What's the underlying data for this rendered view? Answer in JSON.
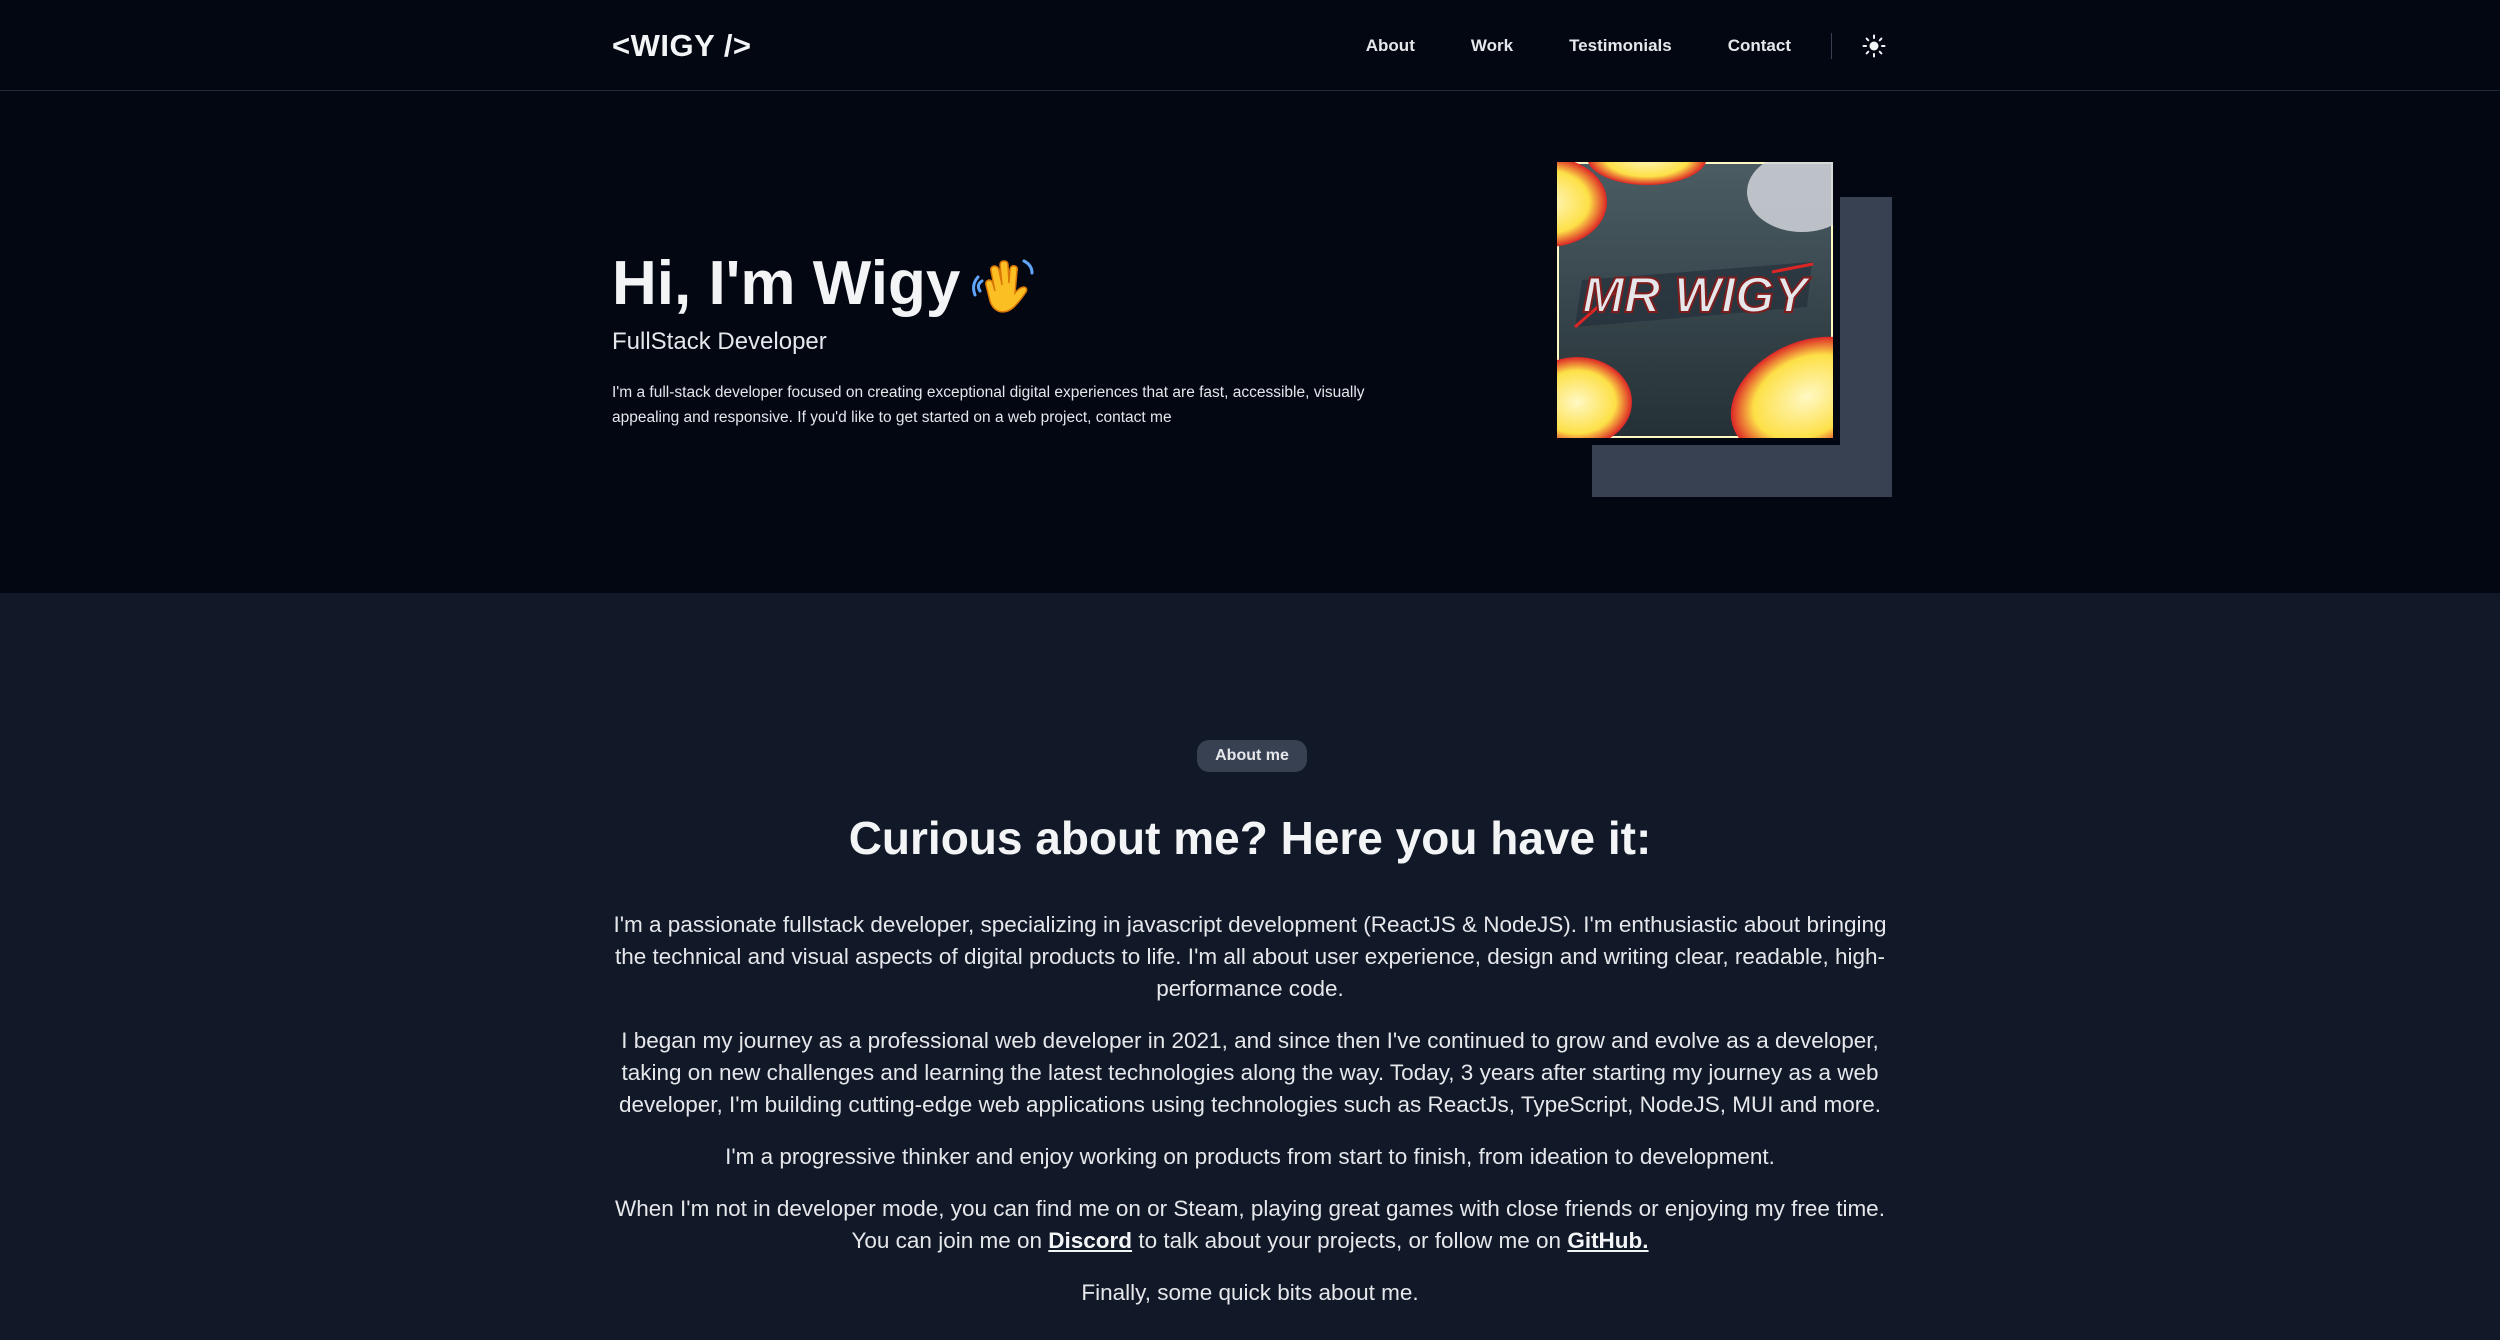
{
  "header": {
    "logo": "<WIGY />",
    "nav": [
      {
        "label": "About"
      },
      {
        "label": "Work"
      },
      {
        "label": "Testimonials"
      },
      {
        "label": "Contact"
      }
    ],
    "theme_toggle_icon": "sun-icon"
  },
  "hero": {
    "title": "Hi, I'm Wigy",
    "wave_icon": "waving-hand-icon",
    "subtitle": "FullStack Developer",
    "description": "I'm a full-stack developer focused on creating exceptional digital experiences that are fast, accessible, visually appealing and responsive. If you'd like to get started on a web project, contact me",
    "image_logo_text": "MR WIGY"
  },
  "about": {
    "badge": "About me",
    "heading": "Curious about me? Here you have it:",
    "p1": "I'm a passionate fullstack developer, specializing in javascript development (ReactJS & NodeJS). I'm enthusiastic about bringing the technical and visual aspects of digital products to life. I'm all about user experience, design and writing clear, readable, high-performance code.",
    "p2": "I began my journey as a professional web developer in 2021, and since then I've continued to grow and evolve as a developer, taking on new challenges and learning the latest technologies along the way. Today, 3 years after starting my journey as a web developer, I'm building cutting-edge web applications using technologies such as ReactJs, TypeScript, NodeJS, MUI and more.",
    "p3": "I'm a progressive thinker and enjoy working on products from start to finish, from ideation to development.",
    "p4_start": "When I'm not in developer mode, you can find me on or Steam, playing great games with close friends or enjoying my free time. You can join me on",
    "discord_label": "Discord",
    "p4_middle": "to talk about your projects, or follow me on",
    "github_label": "GitHub.",
    "p5": "Finally, some quick bits about me."
  },
  "colors": {
    "background_dark": "#030712",
    "background_section": "#111827",
    "accent_gray": "#374151",
    "text": "#f3f4f6"
  }
}
